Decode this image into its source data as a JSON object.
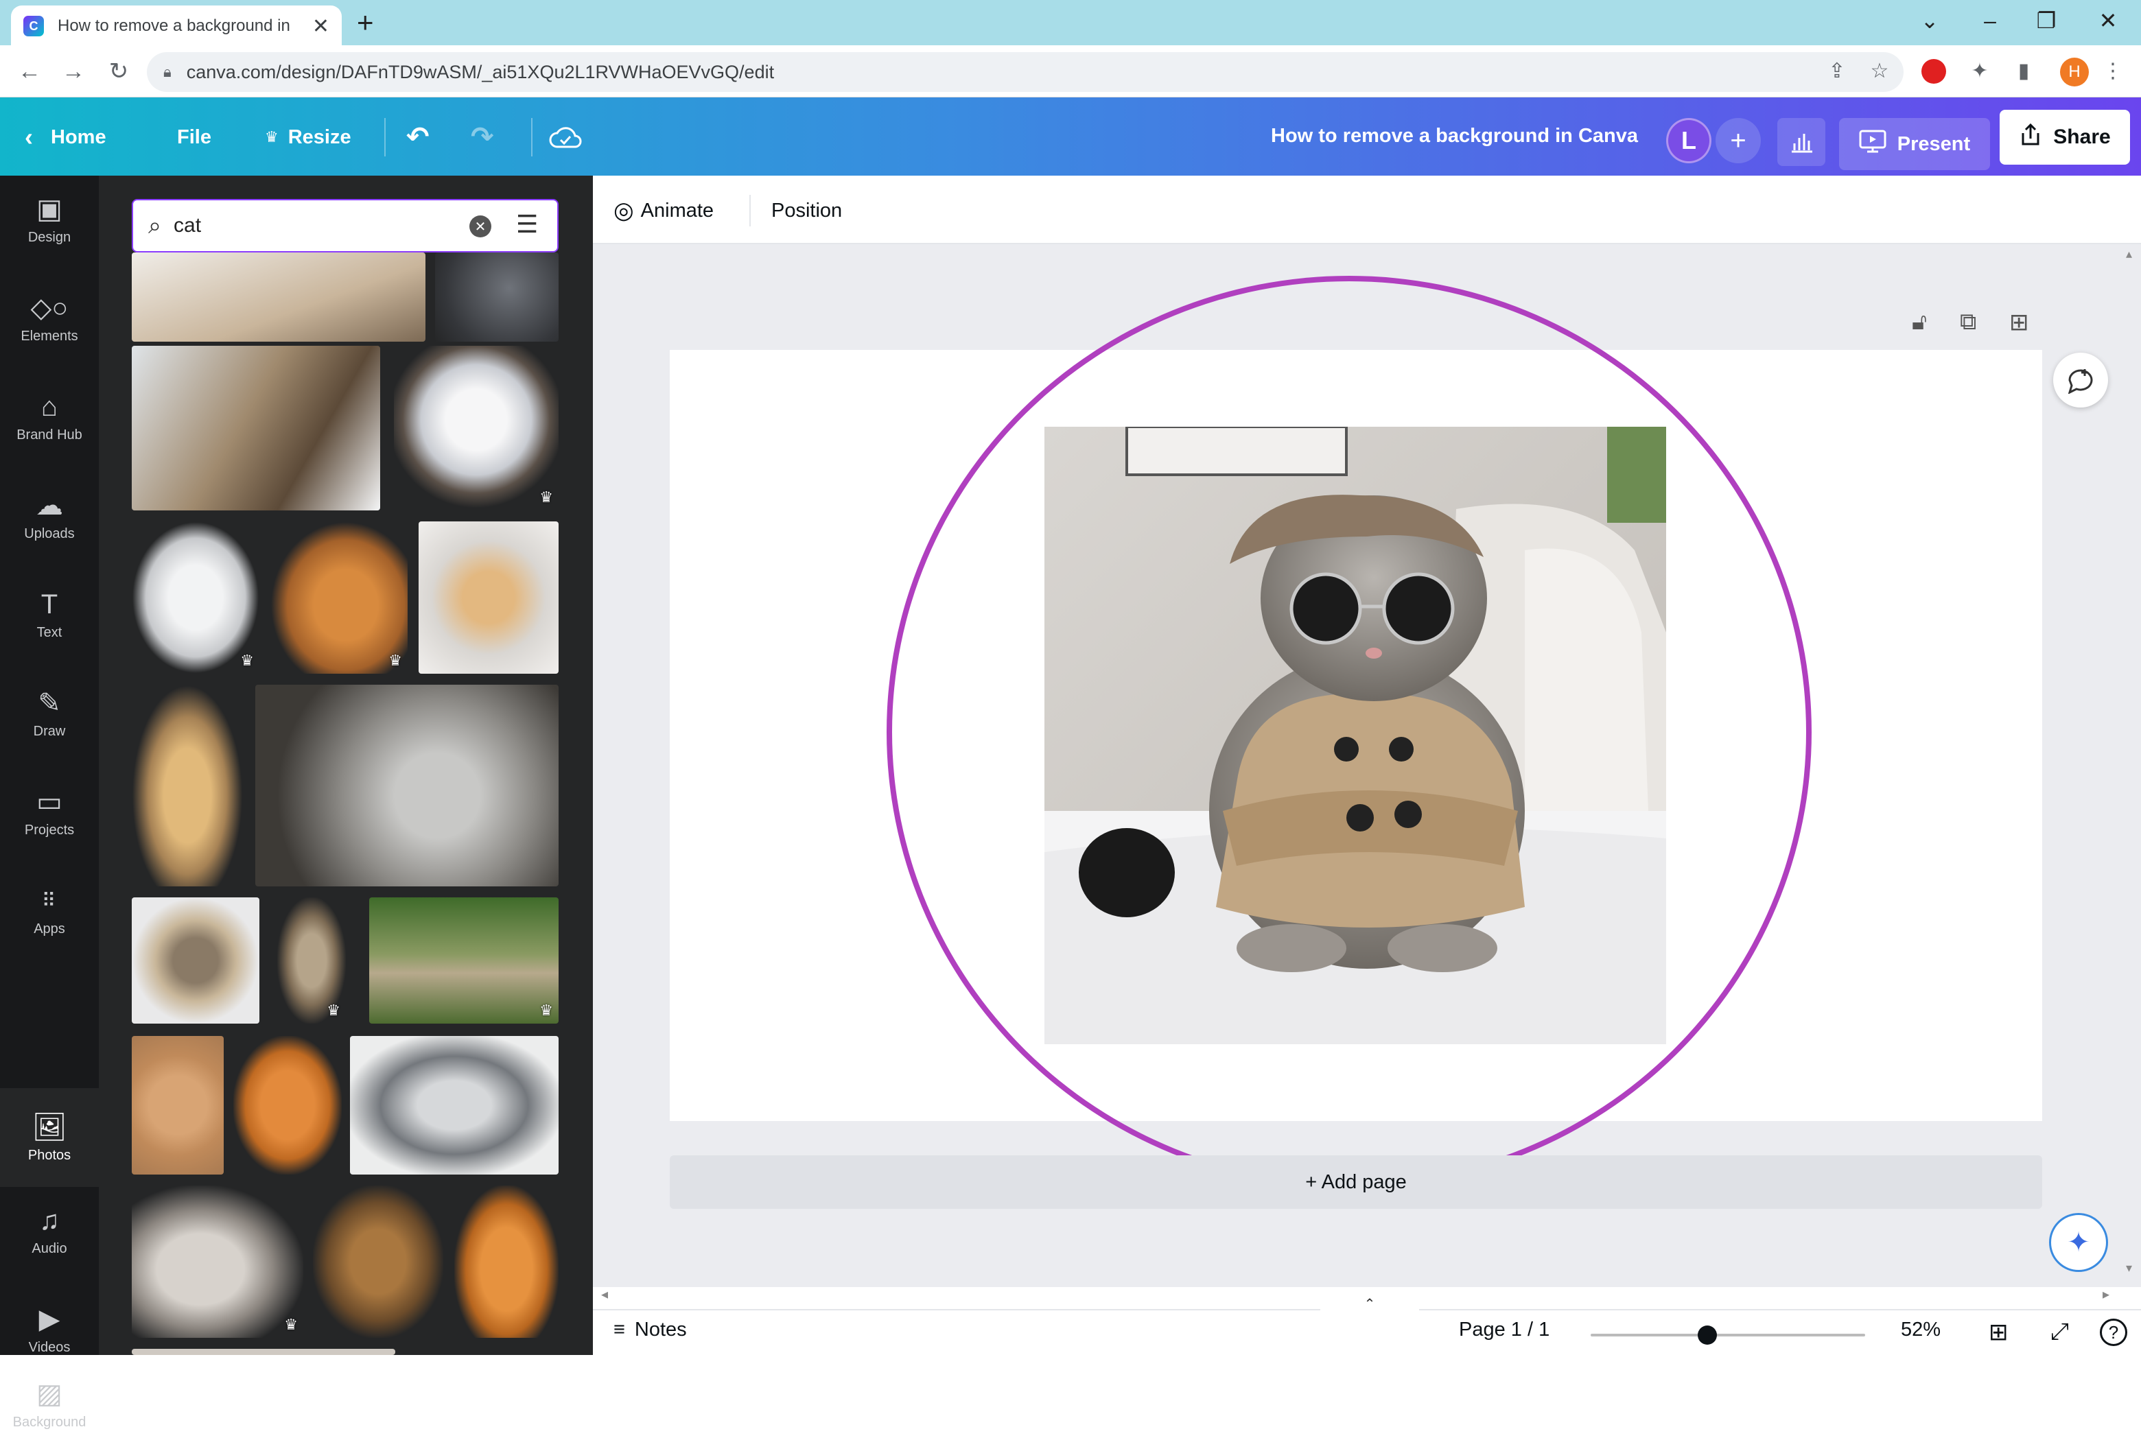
{
  "browser": {
    "tab_title": "How to remove a background in Canva - Canva",
    "tab_title_visible": "How to remove a background in",
    "url": "canva.com/design/DAFnTD9wASM/_ai51XQu2L1RVWHaOEVvGQ/edit",
    "profile_initial": "H"
  },
  "header": {
    "home": "Home",
    "file": "File",
    "resize": "Resize",
    "doc_title": "How to remove a background in Canva",
    "user_initial": "L",
    "present": "Present",
    "share": "Share"
  },
  "rail": [
    {
      "label": "Design",
      "icon": "design-icon"
    },
    {
      "label": "Elements",
      "icon": "elements-icon"
    },
    {
      "label": "Brand Hub",
      "icon": "brand-hub-icon"
    },
    {
      "label": "Uploads",
      "icon": "upload-icon"
    },
    {
      "label": "Text",
      "icon": "text-icon"
    },
    {
      "label": "Draw",
      "icon": "draw-icon"
    },
    {
      "label": "Projects",
      "icon": "folder-icon"
    },
    {
      "label": "Apps",
      "icon": "apps-icon"
    },
    {
      "label": "Photos",
      "icon": "photos-icon"
    },
    {
      "label": "Audio",
      "icon": "audio-icon"
    },
    {
      "label": "Videos",
      "icon": "video-icon"
    },
    {
      "label": "Background",
      "icon": "background-icon"
    }
  ],
  "search": {
    "value": "cat"
  },
  "toolbar": {
    "animate": "Animate",
    "position": "Position"
  },
  "canvas": {
    "add_page": "+ Add page",
    "ring_color": "#b03fbf"
  },
  "bottom": {
    "notes": "Notes",
    "page": "Page 1 / 1",
    "zoom": "52%",
    "zoom_level": 0.52
  },
  "colors": {
    "brand_gradient_start": "#12b5cb",
    "brand_gradient_end": "#6a45ee",
    "panel_bg": "#252627",
    "rail_bg": "#18191b"
  }
}
